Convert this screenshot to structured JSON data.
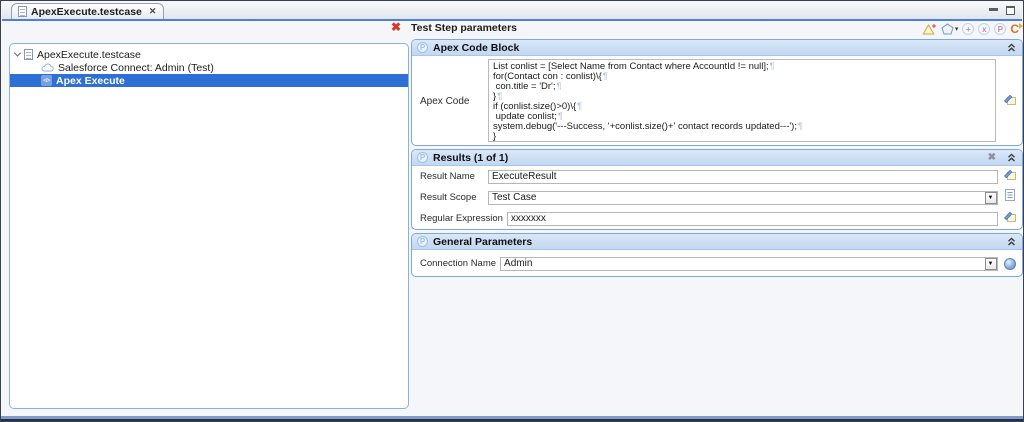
{
  "editor_tab": {
    "title": "ApexExecute.testcase",
    "close_icon": "✕"
  },
  "tree": {
    "items": [
      {
        "label": "ApexExecute.testcase",
        "icon": "testcase-file",
        "level": 0,
        "expanded": true,
        "selected": false
      },
      {
        "label": "Salesforce Connect: Admin (Test)",
        "icon": "salesforce-cloud",
        "level": 1,
        "selected": false
      },
      {
        "label": "Apex Execute",
        "icon": "apex-code",
        "level": 1,
        "selected": true
      }
    ]
  },
  "params_panel": {
    "title": "Test Step parameters",
    "delete_step_icon": "delete-test-step-red-x",
    "toolbar_icons": [
      "add-alert-icon",
      "tag-dropdown-icon",
      "add-circle-icon",
      "variable-circle-icon",
      "parameter-circle-icon",
      "refresh-c-icon"
    ]
  },
  "apex_section": {
    "title": "Apex Code Block",
    "field_label": "Apex Code",
    "eol_mark": "¶",
    "code_lines": [
      {
        "text": "List conlist = [Select Name from Contact where AccountId != null];",
        "eol": true
      },
      {
        "text": "for(Contact con : conlist)\\{",
        "eol": true
      },
      {
        "text": " con.title = 'Dr';",
        "eol": true
      },
      {
        "text": "}",
        "eol": true
      },
      {
        "text": "if (conlist.size()>0)\\{",
        "eol": true
      },
      {
        "text": " update conlist;",
        "eol": true
      },
      {
        "text": "system.debug('---Success, '+conlist.size()+' contact records updated---');",
        "eol": true
      },
      {
        "text": "}",
        "eol": false
      }
    ]
  },
  "results_section": {
    "title": "Results (1 of 1)",
    "rows": [
      {
        "label": "Result Name",
        "value": "ExecuteResult",
        "control": "text"
      },
      {
        "label": "Result Scope",
        "value": "Test Case",
        "control": "dropdown"
      },
      {
        "label": "Regular Expression",
        "value": "xxxxxxx",
        "control": "text"
      }
    ]
  },
  "general_section": {
    "title": "General Parameters",
    "rows": [
      {
        "label": "Connection Name",
        "value": "Admin",
        "control": "dropdown"
      }
    ]
  }
}
